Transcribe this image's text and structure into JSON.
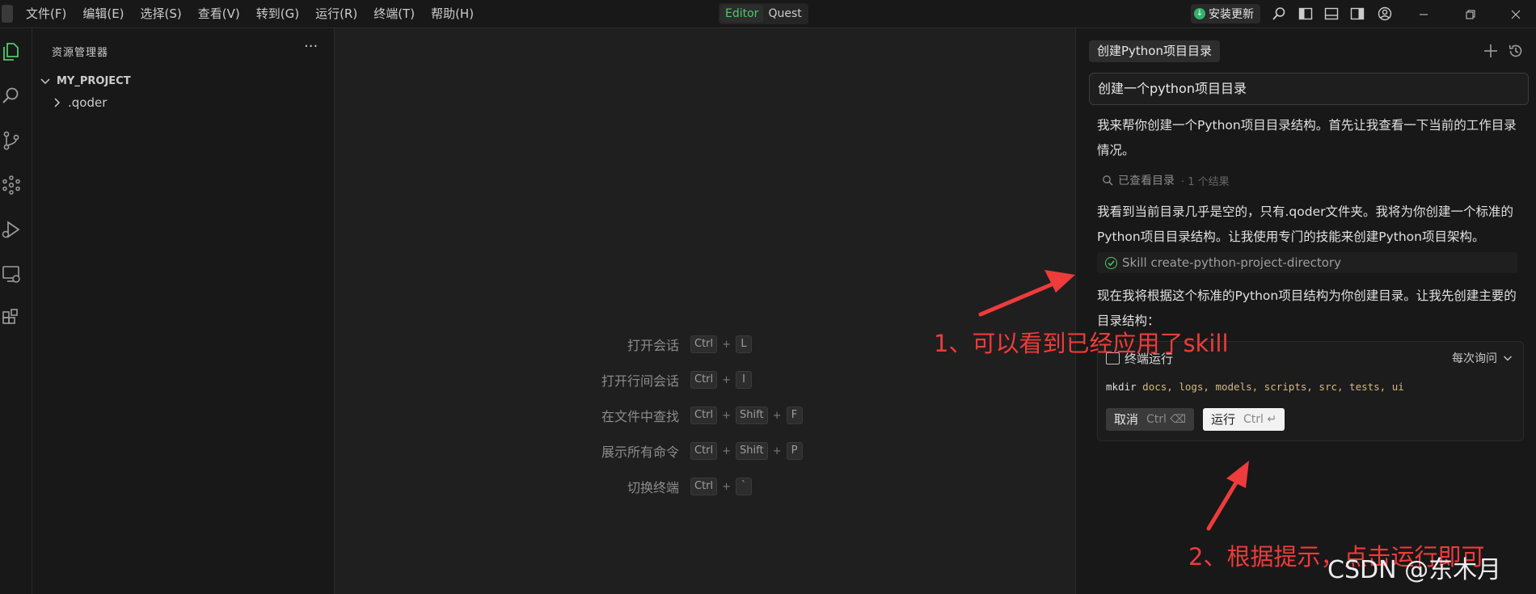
{
  "menu": [
    "文件(F)",
    "编辑(E)",
    "选择(S)",
    "查看(V)",
    "转到(G)",
    "运行(R)",
    "终端(T)",
    "帮助(H)"
  ],
  "mode_switch": {
    "editor": "Editor",
    "quest": "Quest",
    "active": "Editor"
  },
  "update_button": "安装更新",
  "explorer": {
    "title": "资源管理器",
    "more": "···",
    "project": "MY_PROJECT",
    "folders": [
      ".qoder"
    ]
  },
  "hints": [
    {
      "label": "打开会话",
      "keys": [
        "Ctrl",
        "L"
      ]
    },
    {
      "label": "打开行间会话",
      "keys": [
        "Ctrl",
        "I"
      ]
    },
    {
      "label": "在文件中查找",
      "keys": [
        "Ctrl",
        "Shift",
        "F"
      ]
    },
    {
      "label": "展示所有命令",
      "keys": [
        "Ctrl",
        "Shift",
        "P"
      ]
    },
    {
      "label": "切换终端",
      "keys": [
        "Ctrl",
        "`"
      ]
    }
  ],
  "chat": {
    "tab_title": "创建Python项目目录",
    "user_message": "创建一个python项目目录",
    "paragraph1": "我来帮你创建一个Python项目目录结构。首先让我查看一下当前的工作目录情况。",
    "tool_viewed": "已查看目录",
    "tool_viewed_count": "· 1 个结果",
    "paragraph2": "我看到当前目录几乎是空的，只有.qoder文件夹。我将为你创建一个标准的Python项目目录结构。让我使用专门的技能来创建Python项目架构。",
    "skill": "Skill create-python-project-directory",
    "paragraph3": "现在我将根据这个标准的Python项目结构为你创建目录。让我先创建主要的目录结构：",
    "terminal": {
      "title": "终端运行",
      "policy": "每次询问",
      "command_name": "mkdir",
      "command_args": "docs, logs, models, scripts, src, tests, ui",
      "cancel_label": "取消",
      "cancel_shortcut": "Ctrl ⌫",
      "run_label": "运行",
      "run_shortcut": "Ctrl ↵"
    }
  },
  "annotations": {
    "note1": "1、可以看到已经应用了skill",
    "note2": "2、根据提示，点击运行即可"
  },
  "watermark": "CSDN @东木月",
  "colors": {
    "annotation": "#ee3b3b",
    "accent_green": "#4ec96b",
    "update_green": "#33b36b"
  }
}
